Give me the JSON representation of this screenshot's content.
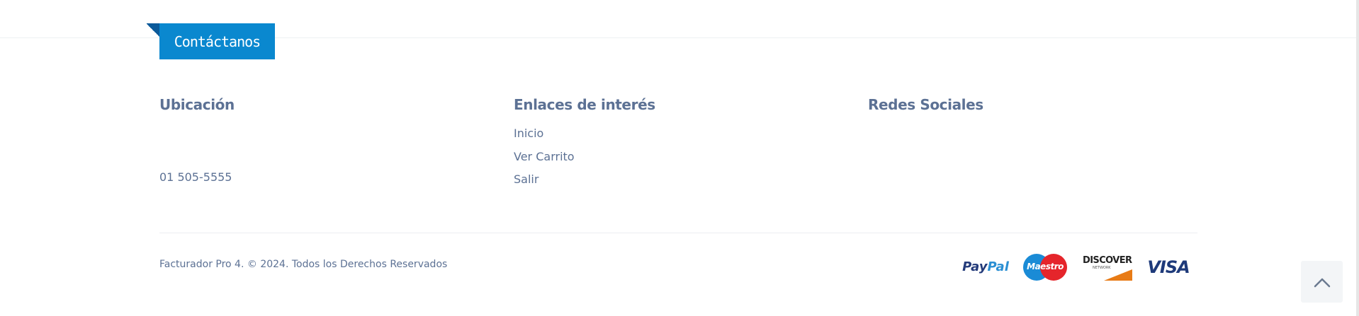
{
  "contact_tab": {
    "label": "Contáctanos"
  },
  "columns": {
    "location": {
      "title": "Ubicación",
      "phone": "01 505-5555"
    },
    "links": {
      "title": "Enlaces de interés",
      "items": [
        "Inicio",
        "Ver Carrito",
        "Salir"
      ]
    },
    "social": {
      "title": "Redes Sociales"
    }
  },
  "footer": {
    "copyright": "Facturador Pro 4. © 2024. Todos los Derechos Reservados",
    "payments": {
      "paypal_a": "Pay",
      "paypal_b": "Pal",
      "maestro": "Maestro",
      "discover": "DISCOVER",
      "discover_sub": "NETWORK",
      "visa": "VISA"
    }
  },
  "icons": {
    "scroll_top": "chevron-up-icon"
  },
  "colors": {
    "accent": "#0a88cf",
    "text": "#5c7194"
  }
}
